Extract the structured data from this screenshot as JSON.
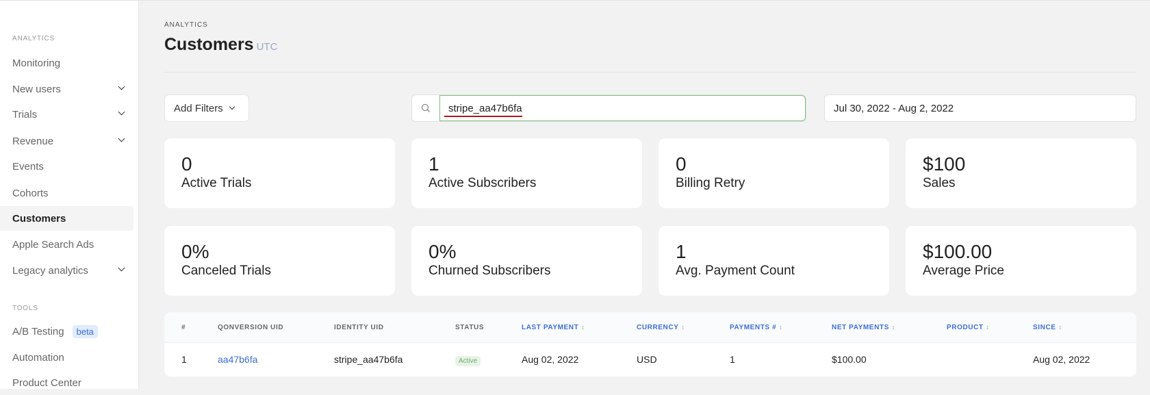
{
  "sidebar": {
    "analytics_label": "ANALYTICS",
    "items": [
      {
        "label": "Monitoring"
      },
      {
        "label": "New users"
      },
      {
        "label": "Trials"
      },
      {
        "label": "Revenue"
      },
      {
        "label": "Events"
      },
      {
        "label": "Cohorts"
      },
      {
        "label": "Customers"
      },
      {
        "label": "Apple Search Ads"
      },
      {
        "label": "Legacy analytics"
      }
    ],
    "tools_label": "TOOLS",
    "tools": [
      {
        "label": "A/B Testing",
        "badge": "beta"
      },
      {
        "label": "Automation"
      },
      {
        "label": "Product Center"
      }
    ]
  },
  "header": {
    "breadcrumb": "ANALYTICS",
    "title": "Customers",
    "timezone": "UTC"
  },
  "filters": {
    "add_filters": "Add Filters",
    "search_value": "stripe_aa47b6fa",
    "date_range": "Jul 30, 2022 - Aug 2, 2022"
  },
  "stats": [
    {
      "value": "0",
      "label": "Active Trials"
    },
    {
      "value": "1",
      "label": "Active Subscribers"
    },
    {
      "value": "0",
      "label": "Billing Retry"
    },
    {
      "value": "$100",
      "label": "Sales"
    },
    {
      "value": "0%",
      "label": "Canceled Trials"
    },
    {
      "value": "0%",
      "label": "Churned Subscribers"
    },
    {
      "value": "1",
      "label": "Avg. Payment Count"
    },
    {
      "value": "$100.00",
      "label": "Average Price"
    }
  ],
  "table": {
    "columns": [
      "#",
      "QONVERSION UID",
      "IDENTITY UID",
      "STATUS",
      "LAST PAYMENT",
      "CURRENCY",
      "PAYMENTS #",
      "NET PAYMENTS",
      "PRODUCT",
      "SINCE"
    ],
    "rows": [
      {
        "num": "1",
        "qonversion_uid": "aa47b6fa",
        "identity_uid": "stripe_aa47b6fa",
        "status": "Active",
        "last_payment": "Aug 02, 2022",
        "currency": "USD",
        "payments": "1",
        "net_payments": "$100.00",
        "product": "",
        "since": "Aug 02, 2022"
      }
    ]
  }
}
